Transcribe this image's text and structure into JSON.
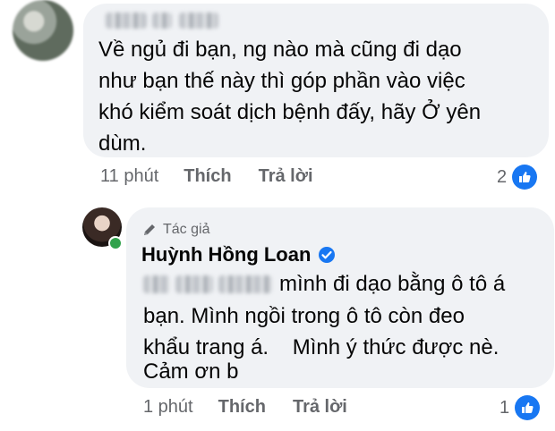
{
  "comment_1": {
    "text": "Về ngủ đi bạn, ng nào mà cũng đi dạo\nnhư bạn thế này thì góp phần vào việc\nkhó kiểm soát dịch bệnh đấy, hãy Ở yên\ndùm.",
    "time": "11 phút",
    "like_label": "Thích",
    "reply_label": "Trả lời",
    "reaction_count": "2",
    "reaction_icon": "like-icon"
  },
  "comment_2": {
    "badge": "Tác giả",
    "badge_icon": "pen-icon",
    "author": "Huỳnh Hồng Loan",
    "verified_icon": "verified-badge-icon",
    "line_1": "mình đi dạo bằng ô tô á",
    "line_2": "bạn. Mình ngồi trong ô tô còn đeo",
    "line_3": "khẩu trang á.    Mình ý thức được nè.",
    "line_4": "Cảm ơn b",
    "time": "1 phút",
    "like_label": "Thích",
    "reply_label": "Trả lời",
    "reaction_count": "1",
    "reaction_icon": "like-icon"
  },
  "colors": {
    "bubble": "#f0f2f5",
    "meta_text": "#65676b",
    "like_blue": "#1877f2",
    "online_green": "#31a24c"
  }
}
